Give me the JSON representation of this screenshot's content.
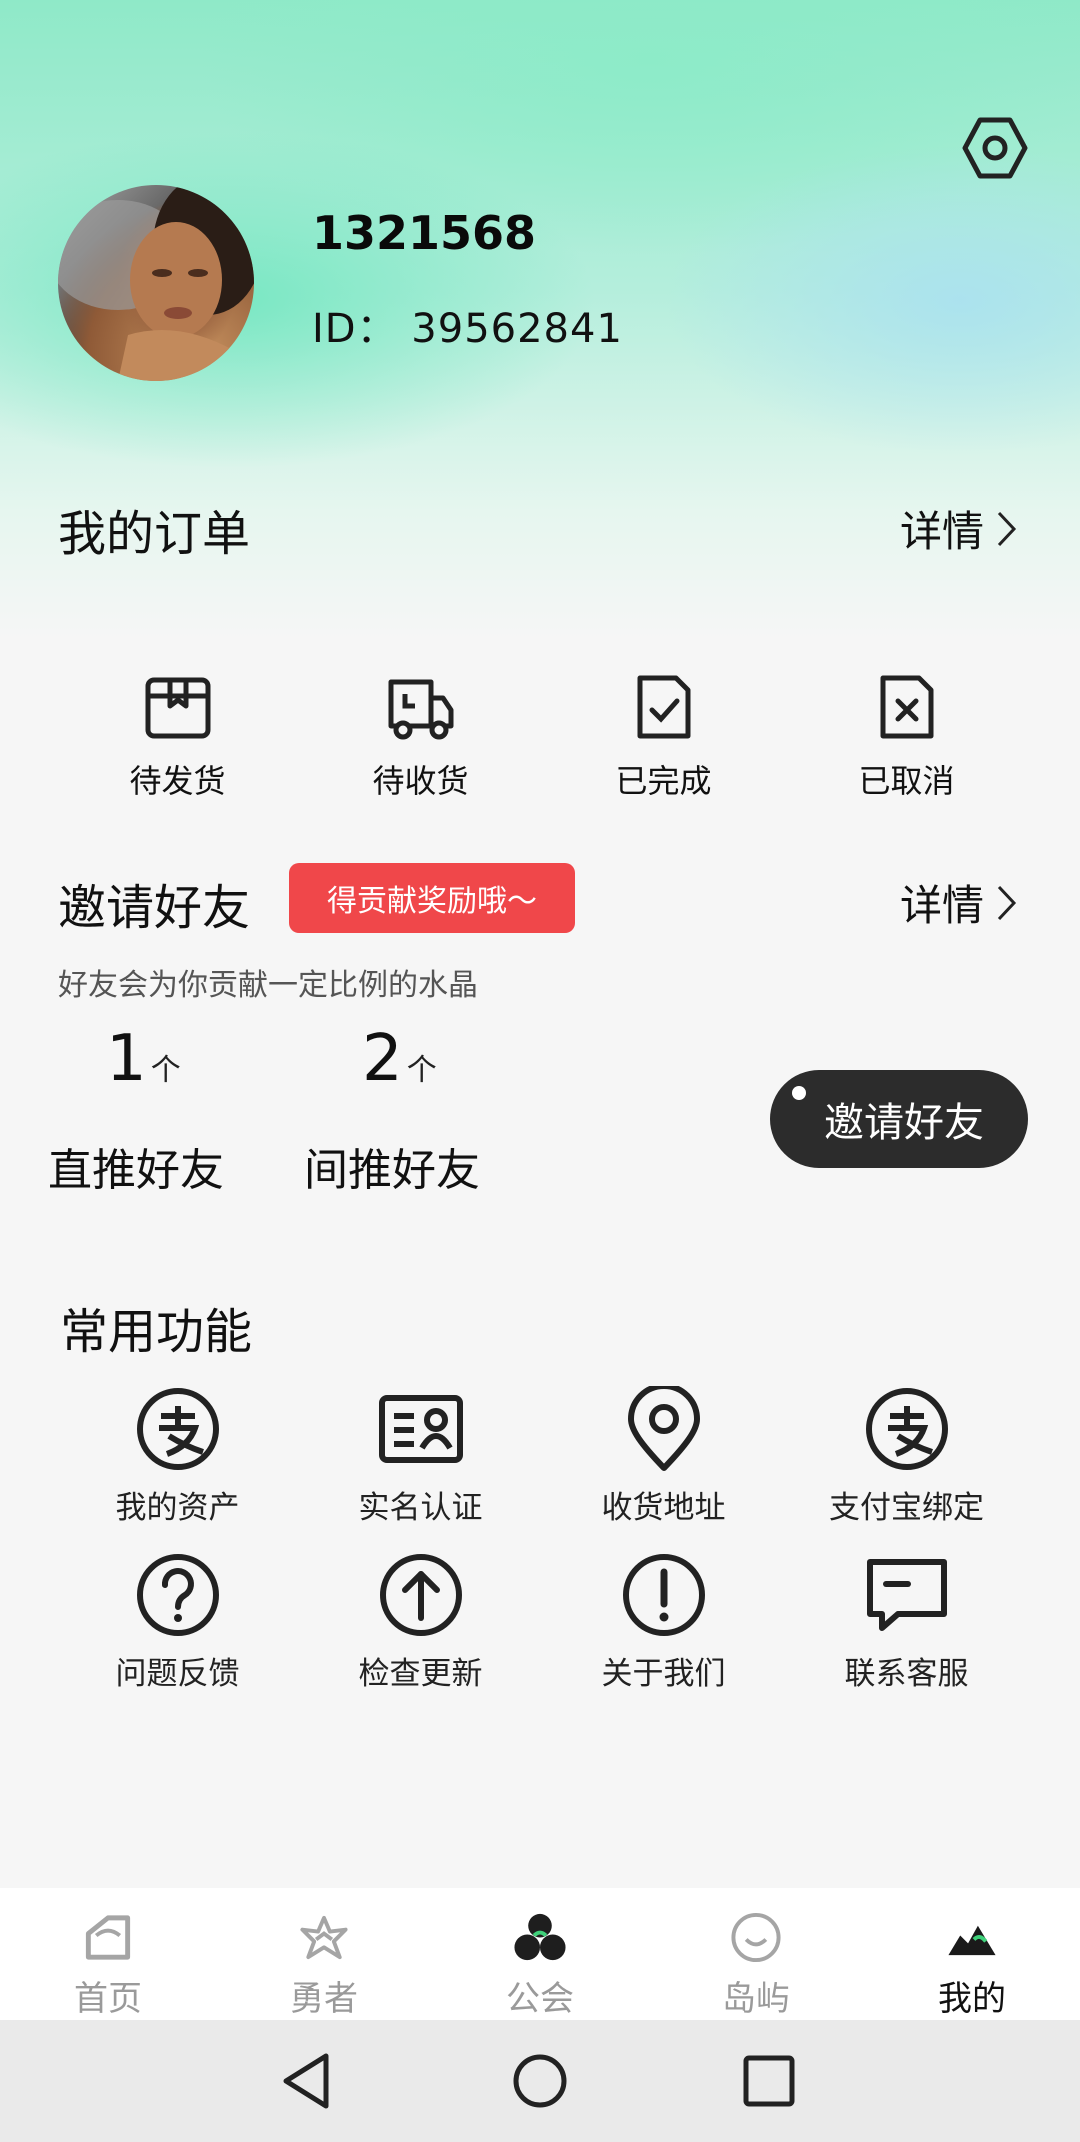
{
  "profile": {
    "username": "1321568",
    "id_text": "ID：  39562841"
  },
  "orders": {
    "title": "我的订单",
    "detail": "详情",
    "items": [
      {
        "label": "待发货",
        "icon": "box-icon"
      },
      {
        "label": "待收货",
        "icon": "truck-icon"
      },
      {
        "label": "已完成",
        "icon": "document-check-icon"
      },
      {
        "label": "已取消",
        "icon": "document-x-icon"
      }
    ]
  },
  "invite": {
    "title": "邀请好友",
    "badge": "得贡献奖励哦～",
    "detail": "详情",
    "subtitle": "好友会为你贡献一定比例的水晶",
    "direct": {
      "count": "1",
      "unit": "个",
      "label": "直推好友"
    },
    "indirect": {
      "count": "2",
      "unit": "个",
      "label": "间推好友"
    },
    "button": "邀请好友"
  },
  "functions": {
    "title": "常用功能",
    "items": [
      {
        "label": "我的资产",
        "icon": "alipay-icon"
      },
      {
        "label": "实名认证",
        "icon": "id-card-icon"
      },
      {
        "label": "收货地址",
        "icon": "location-pin-icon"
      },
      {
        "label": "支付宝绑定",
        "icon": "alipay-icon"
      },
      {
        "label": "问题反馈",
        "icon": "question-icon"
      },
      {
        "label": "检查更新",
        "icon": "arrow-up-circle-icon"
      },
      {
        "label": "关于我们",
        "icon": "exclamation-icon"
      },
      {
        "label": "联系客服",
        "icon": "chat-bubble-icon"
      }
    ]
  },
  "tabbar": {
    "items": [
      {
        "label": "首页",
        "icon": "home-icon",
        "active": false
      },
      {
        "label": "勇者",
        "icon": "star-icon",
        "active": false
      },
      {
        "label": "公会",
        "icon": "guild-icon",
        "active": false
      },
      {
        "label": "岛屿",
        "icon": "island-icon",
        "active": false
      },
      {
        "label": "我的",
        "icon": "mountain-icon",
        "active": true
      }
    ]
  },
  "colors": {
    "accent_red": "#f0474a",
    "dark_button": "#2c2c2c",
    "hero_green": "#8fe9c8"
  }
}
